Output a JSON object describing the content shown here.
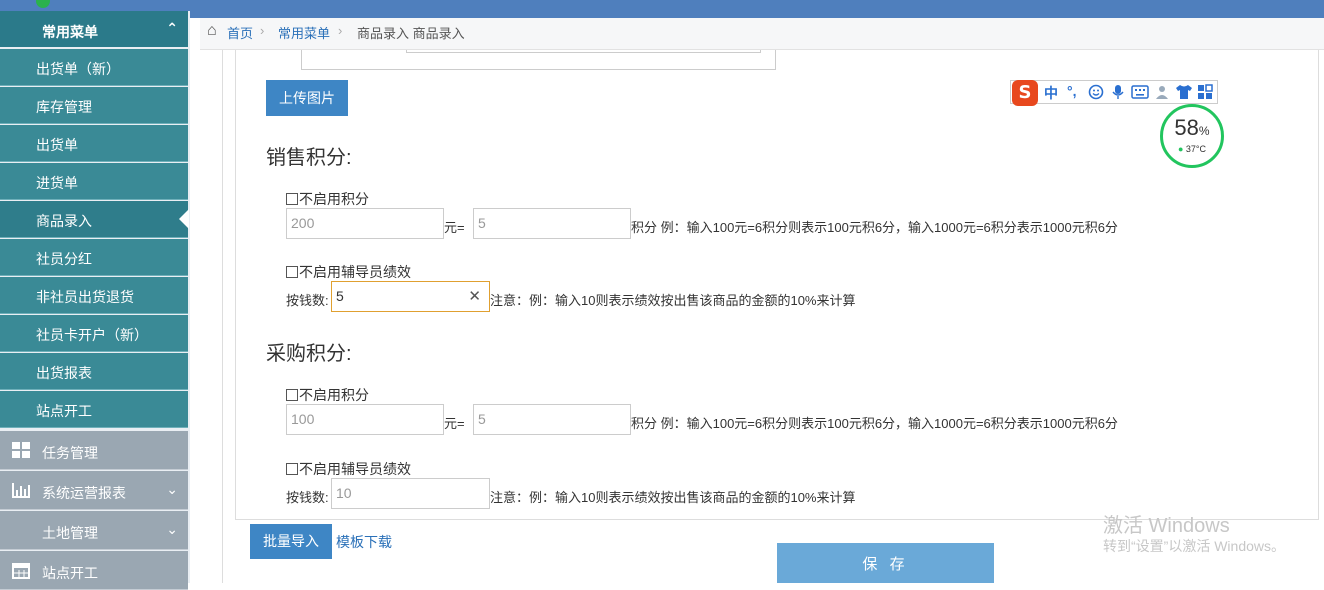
{
  "sidebar": {
    "header": "常用菜单",
    "items": [
      "出货单（新）",
      "库存管理",
      "出货单",
      "进货单",
      "商品录入",
      "社员分红",
      "非社员出货退货",
      "社员卡开户（新）",
      "出货报表",
      "站点开工"
    ],
    "groups": [
      "任务管理",
      "系统运营报表",
      "土地管理",
      "站点开工"
    ]
  },
  "breadcrumb": {
    "home": "首页",
    "menu": "常用菜单",
    "current": "商品录入 商品录入"
  },
  "upload_label": "上传图片",
  "sales": {
    "title": "销售积分:",
    "disable_points": "不启用积分",
    "amount_value": "200",
    "yuan_eq": "元=",
    "points_value": "5",
    "points_hint": "积分 例：输入100元=6积分则表示100元积6分，输入1000元=6积分表示1000元积6分",
    "disable_guide": "不启用辅导员绩效",
    "money_label": "按钱数:",
    "money_value": "5",
    "money_hint": "注意：例：输入10则表示绩效按出售该商品的金额的10%来计算"
  },
  "purchase": {
    "title": "采购积分:",
    "disable_points": "不启用积分",
    "amount_value": "100",
    "yuan_eq": "元=",
    "points_value": "5",
    "points_hint": "积分 例：输入100元=6积分则表示100元积6分，输入1000元=6积分表示1000元积6分",
    "disable_guide": "不启用辅导员绩效",
    "money_label": "按钱数:",
    "money_value": "10",
    "money_hint": "注意：例：输入10则表示绩效按出售该商品的金额的10%来计算"
  },
  "import_label": "批量导入",
  "template_label": "模板下载",
  "save_label": "保 存",
  "ime": {
    "logo": "S",
    "lang": "中",
    "punct": "°,"
  },
  "gauge": {
    "percent": "58",
    "unit": "%",
    "temp": "37°C",
    "color": "#22c55e"
  },
  "watermark": {
    "line1": "激活 Windows",
    "line2": "转到“设置”以激活 Windows。"
  }
}
